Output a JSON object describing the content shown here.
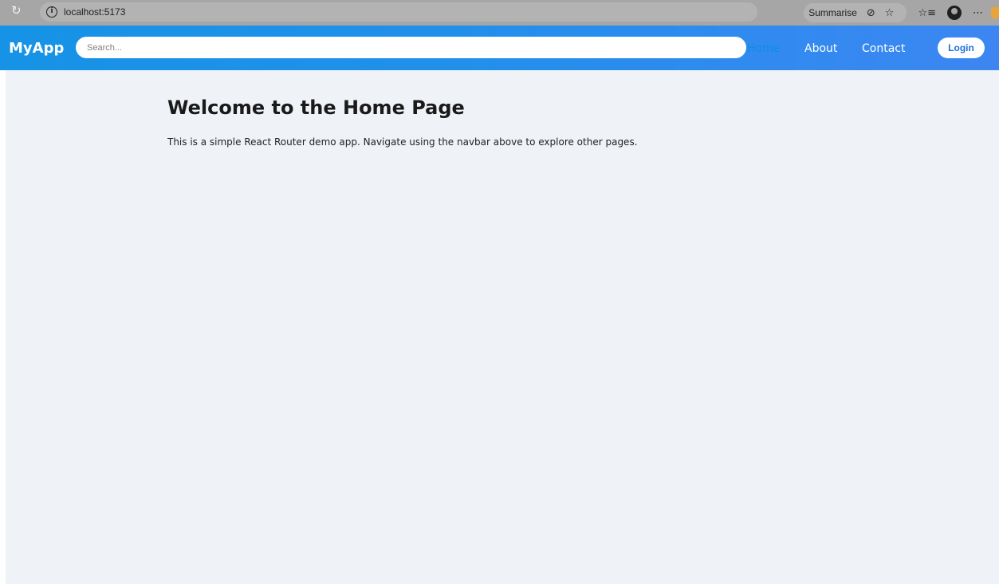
{
  "browser": {
    "url": "localhost:5173",
    "summarise_label": "Summarise",
    "reload_icon": "reload-icon",
    "info_icon": "info-icon"
  },
  "navbar": {
    "brand": "MyApp",
    "search_placeholder": "Search...",
    "links": [
      {
        "label": "Home",
        "active": true
      },
      {
        "label": "About",
        "active": false
      },
      {
        "label": "Contact",
        "active": false
      }
    ],
    "login_label": "Login",
    "colors": {
      "gradient_start": "#1693e6",
      "gradient_end": "#3d86f2",
      "active_link": "#0a8fe5"
    }
  },
  "main": {
    "title": "Welcome to the Home Page",
    "description": "This is a simple React Router demo app. Navigate using the navbar above to explore other pages.",
    "background": "#eff2f7"
  }
}
